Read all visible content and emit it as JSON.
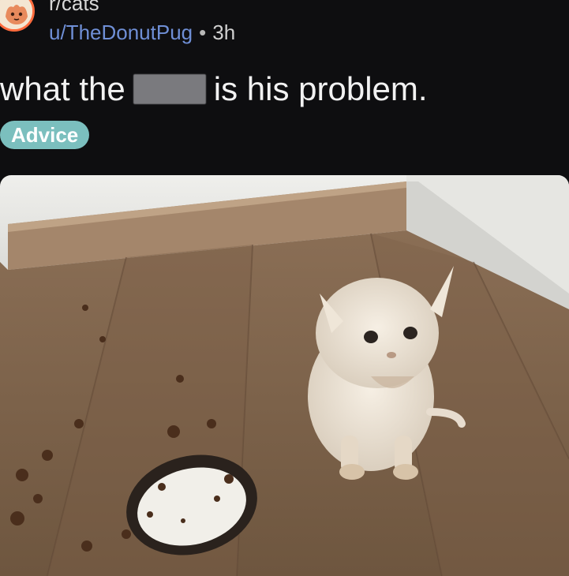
{
  "post": {
    "subreddit": "r/cats",
    "username": "u/TheDonutPug",
    "separator": "•",
    "age": "3h",
    "title_before": "what the",
    "title_after": "is his problem.",
    "flair": "Advice"
  },
  "colors": {
    "background": "#0e0e10",
    "username": "#6f8fd6",
    "flair": "#7bbfbe",
    "censor_bar": "#7a7a7e"
  },
  "icons": {
    "avatar": "subreddit-cat-avatar-icon"
  }
}
